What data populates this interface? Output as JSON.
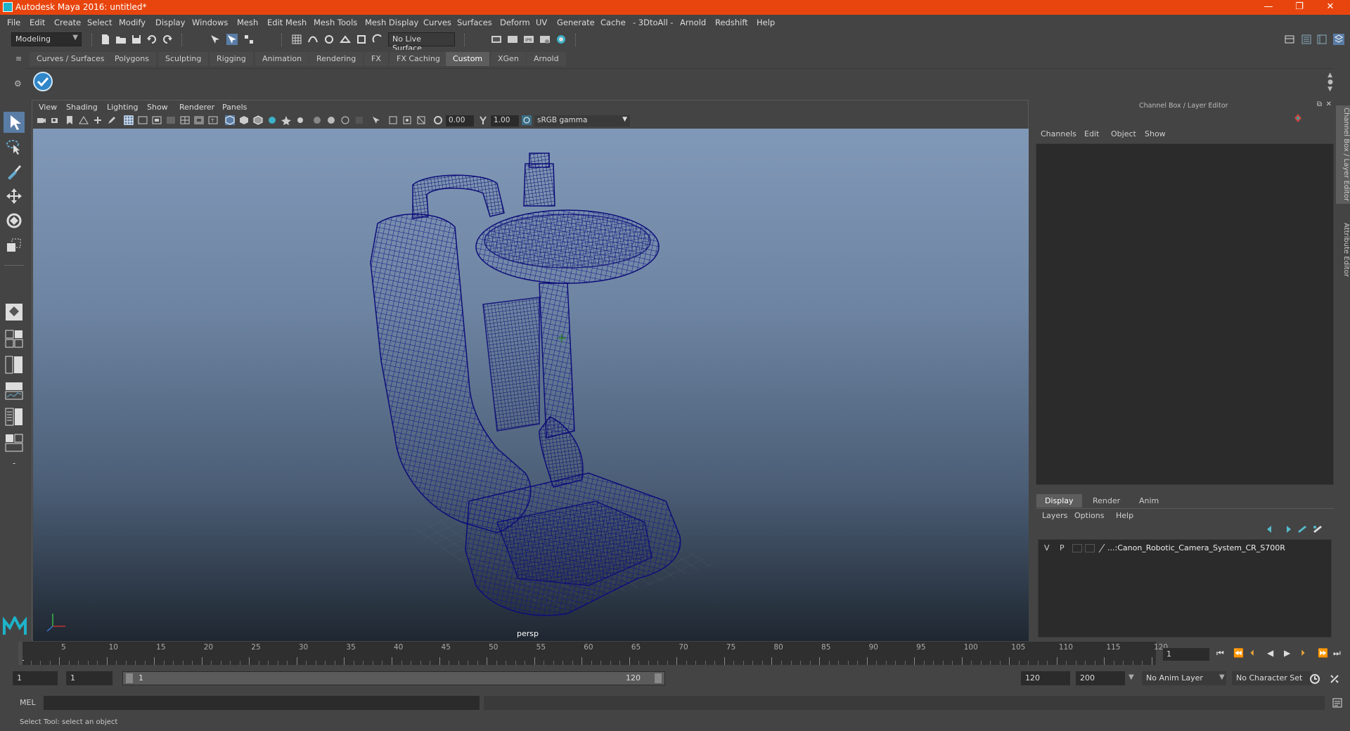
{
  "window": {
    "title": "Autodesk Maya 2016: untitled*",
    "minimize": "—",
    "restore": "❐",
    "close": "✕"
  },
  "menubar": [
    "File",
    "Edit",
    "Create",
    "Select",
    "Modify",
    "Display",
    "Windows",
    "Mesh",
    "Edit Mesh",
    "Mesh Tools",
    "Mesh Display",
    "Curves",
    "Surfaces",
    "Deform",
    "UV",
    "Generate",
    "Cache",
    "- 3DtoAll -",
    "Arnold",
    "Redshift",
    "Help"
  ],
  "statusline": {
    "mode": "Modeling",
    "live_surface": "No Live Surface"
  },
  "shelf_tabs": [
    "Curves / Surfaces",
    "Polygons",
    "Sculpting",
    "Rigging",
    "Animation",
    "Rendering",
    "FX",
    "FX Caching",
    "Custom",
    "XGen",
    "Arnold"
  ],
  "active_shelf_tab": "Custom",
  "panel_menu": [
    "View",
    "Shading",
    "Lighting",
    "Show",
    "Renderer",
    "Panels"
  ],
  "panel_toolbar": {
    "exposure": "0.00",
    "gamma": "1.00",
    "color_space": "sRGB gamma"
  },
  "viewport": {
    "camera_label": "persp"
  },
  "channel_box": {
    "title": "Channel Box / Layer Editor",
    "menu": [
      "Channels",
      "Edit",
      "Object",
      "Show"
    ],
    "layer_tabs": [
      "Display",
      "Render",
      "Anim"
    ],
    "active_layer_tab": "Display",
    "layer_menu": [
      "Layers",
      "Options",
      "Help"
    ],
    "layers": [
      {
        "v": "V",
        "p": "P",
        "name": "...:Canon_Robotic_Camera_System_CR_S700R"
      }
    ],
    "side_tabs": [
      "Channel Box / Layer Editor",
      "Attribute Editor"
    ]
  },
  "time_slider": {
    "labels": [
      "5",
      "10",
      "15",
      "20",
      "25",
      "30",
      "35",
      "40",
      "45",
      "50",
      "55",
      "60",
      "65",
      "70",
      "75",
      "80",
      "85",
      "90",
      "95",
      "100",
      "105",
      "110",
      "115",
      "120"
    ],
    "start_label": "1",
    "current_frame": "1"
  },
  "range": {
    "start": "1",
    "playback_start": "1",
    "range_start_label": "1",
    "range_end_label": "120",
    "playback_end": "120",
    "end": "200",
    "anim_layer": "No Anim Layer",
    "character_set": "No Character Set"
  },
  "command_line": {
    "label": "MEL"
  },
  "help_line": {
    "text": "Select Tool: select an object"
  },
  "colors": {
    "title_bar": "#e8450e",
    "wireframe": "#10107a",
    "active_tab": "#5d5d5d"
  }
}
